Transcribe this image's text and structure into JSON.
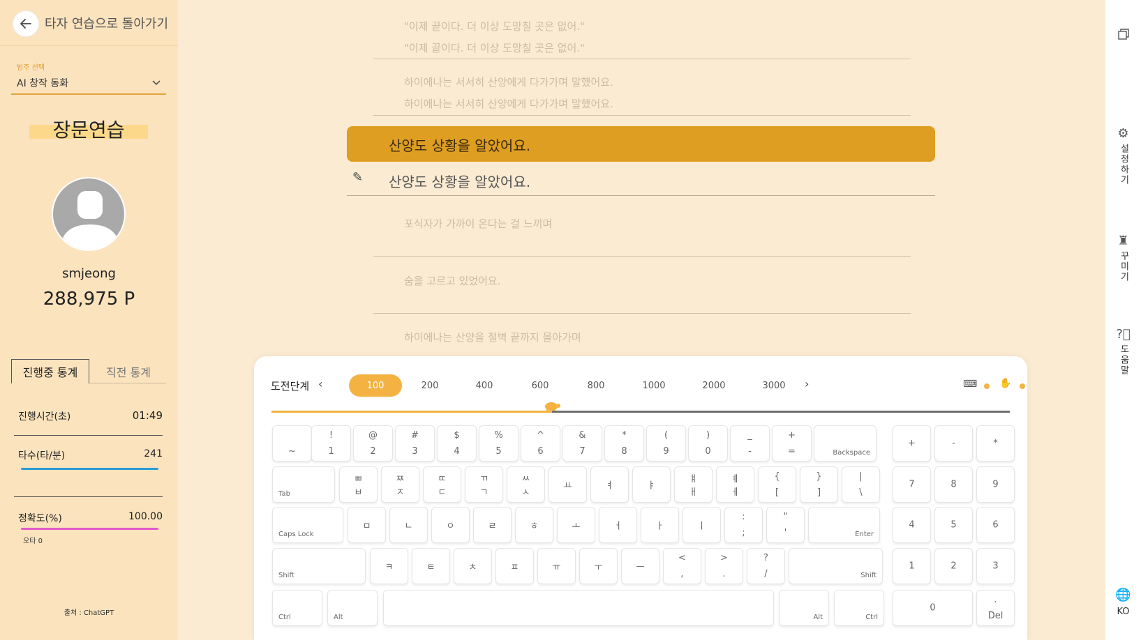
{
  "sidebar": {
    "back_label": "타자 연습으로 돌아가기",
    "category_label": "범주 선택",
    "category_value": "AI 창작 동화",
    "mode_title": "장문연습",
    "username": "smjeong",
    "points": "288,975 P",
    "tabs": [
      "진행중 통계",
      "직전 통계"
    ],
    "stats": {
      "time_label": "진행시간(초)",
      "time_value": "01:49",
      "speed_label": "타수(타/분)",
      "speed_value": "241",
      "accuracy_label": "정확도(%)",
      "accuracy_value": "100.00",
      "typo_label": "오타 0"
    },
    "source": "출처 : ChatGPT"
  },
  "text_area": {
    "prev_lines": [
      {
        "original": "\"이제 끝이다. 더 이상 도망칠 곳은 없어.\"",
        "typed": "\"이제 끝이다. 더 이상 도망칠 곳은 없어.\""
      },
      {
        "original": "하이에나는 서서히 산양에게 다가가며 말했어요.",
        "typed": "하이에나는 서서히 산양에게 다가가며 말했어요."
      }
    ],
    "active_line": "산양도 상황을 알았어요.",
    "input_value": "산양도 상황을 알았어요.",
    "next_lines": [
      "포식자가 가까이 온다는 걸 느끼며",
      "숨을 고르고 있었어요.",
      "하이에나는 산양을 절벽 끝까지 몰아가며"
    ]
  },
  "keyboard": {
    "level_label": "도전단계",
    "levels": [
      "100",
      "200",
      "400",
      "600",
      "800",
      "1000",
      "2000",
      "3000"
    ],
    "active_level": "100",
    "progress": 0.38,
    "accent": "#F4B242"
  },
  "rail": {
    "settings": "설정하기",
    "decorate": "꾸미기",
    "help": "도움말",
    "lang": "KO"
  }
}
